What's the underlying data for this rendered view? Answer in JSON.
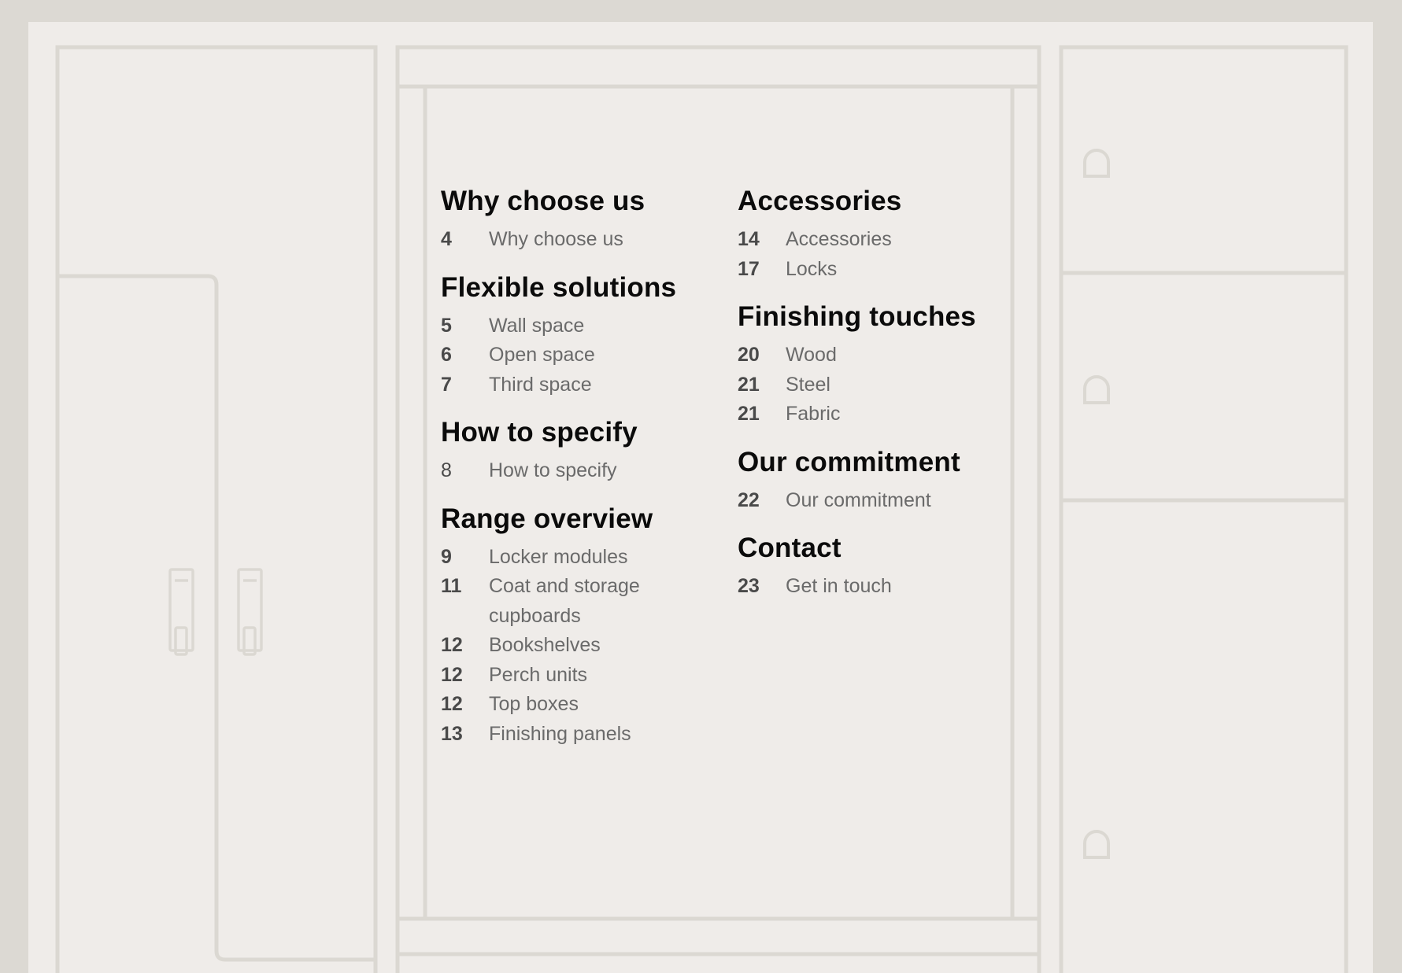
{
  "colors": {
    "background": "#efece9",
    "frame": "#dcd9d3",
    "line": "#dbd8d2",
    "heading": "#0b0b0b",
    "number": "#4a4a4a",
    "label": "#6a6a6a"
  },
  "icons": [
    "door-handle-icon",
    "lock-icon"
  ],
  "toc": {
    "column1": [
      {
        "title": "Why choose us",
        "entries": [
          {
            "page": "4",
            "label": "Why choose us"
          }
        ]
      },
      {
        "title": "Flexible solutions",
        "entries": [
          {
            "page": "5",
            "label": "Wall space"
          },
          {
            "page": "6",
            "label": "Open space"
          },
          {
            "page": "7",
            "label": "Third space"
          }
        ]
      },
      {
        "title": "How to specify",
        "entries": [
          {
            "page": "8",
            "label": "How to specify"
          }
        ]
      },
      {
        "title": "Range overview",
        "entries": [
          {
            "page": "9",
            "label": "Locker modules"
          },
          {
            "page": "11",
            "label": "Coat and storage cupboards"
          },
          {
            "page": "12",
            "label": "Bookshelves"
          },
          {
            "page": "12",
            "label": "Perch units"
          },
          {
            "page": "12",
            "label": "Top boxes"
          },
          {
            "page": "13",
            "label": "Finishing panels"
          }
        ]
      }
    ],
    "column2": [
      {
        "title": "Accessories",
        "entries": [
          {
            "page": "14",
            "label": "Accessories"
          },
          {
            "page": "17",
            "label": "Locks"
          }
        ]
      },
      {
        "title": "Finishing touches",
        "entries": [
          {
            "page": "20",
            "label": "Wood"
          },
          {
            "page": "21",
            "label": "Steel"
          },
          {
            "page": "21",
            "label": "Fabric"
          }
        ]
      },
      {
        "title": "Our commitment",
        "entries": [
          {
            "page": "22",
            "label": "Our commitment"
          }
        ]
      },
      {
        "title": "Contact",
        "entries": [
          {
            "page": "23",
            "label": "Get in touch"
          }
        ]
      }
    ]
  }
}
